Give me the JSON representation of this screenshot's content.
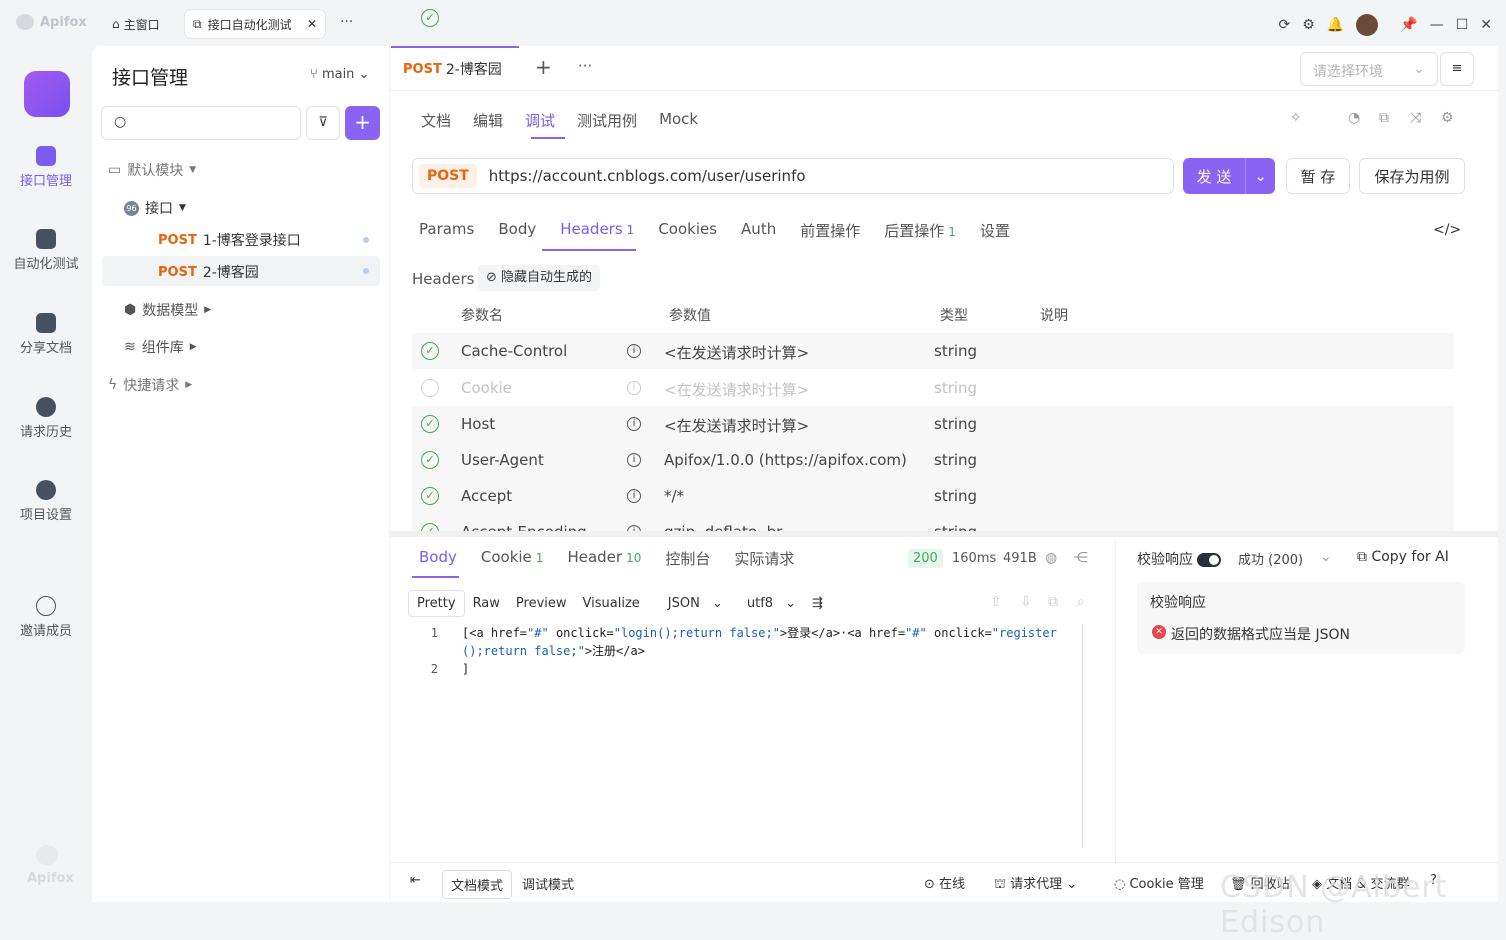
{
  "app": {
    "name": "Apifox"
  },
  "window_tabs": [
    {
      "label": "主窗口"
    },
    {
      "label": "接口自动化测试"
    }
  ],
  "rail": [
    {
      "label": "接口管理"
    },
    {
      "label": "自动化测试"
    },
    {
      "label": "分享文档"
    },
    {
      "label": "请求历史"
    },
    {
      "label": "项目设置"
    },
    {
      "label": "邀请成员"
    }
  ],
  "rail_bottom_logo": "Apifox",
  "nav": {
    "title": "接口管理",
    "branch": "main",
    "tree": {
      "default_module": "默认模块",
      "folder": "接口",
      "folder_badge": "96",
      "items": [
        {
          "method": "POST",
          "name": "1-博客登录接口"
        },
        {
          "method": "POST",
          "name": "2-博客园"
        }
      ],
      "data_models": "数据模型",
      "components": "组件库",
      "quick": "快捷请求"
    }
  },
  "request_tab": {
    "method": "POST",
    "name": "2-博客园"
  },
  "env": {
    "placeholder": "请选择环境"
  },
  "subtabs": [
    "文档",
    "编辑",
    "调试",
    "测试用例",
    "Mock"
  ],
  "url": {
    "method": "POST",
    "value": "https://account.cnblogs.com/user/userinfo"
  },
  "buttons": {
    "send": "发 送",
    "save": "暂 存",
    "save_case": "保存为用例"
  },
  "param_tabs": [
    {
      "label": "Params"
    },
    {
      "label": "Body"
    },
    {
      "label": "Headers",
      "count": "1"
    },
    {
      "label": "Cookies"
    },
    {
      "label": "Auth"
    },
    {
      "label": "前置操作"
    },
    {
      "label": "后置操作",
      "count": "1"
    },
    {
      "label": "设置"
    }
  ],
  "headers_section": {
    "label": "Headers",
    "hide_auto": "隐藏自动生成的"
  },
  "headers_table": {
    "columns": [
      "参数名",
      "参数值",
      "类型",
      "说明"
    ],
    "rows": [
      {
        "name": "Cache-Control",
        "value": "<在发送请求时计算>",
        "type": "string"
      },
      {
        "name": "Cookie",
        "value": "<在发送请求时计算>",
        "type": "string"
      },
      {
        "name": "Host",
        "value": "<在发送请求时计算>",
        "type": "string"
      },
      {
        "name": "User-Agent",
        "value": "Apifox/1.0.0 (https://apifox.com)",
        "type": "string"
      },
      {
        "name": "Accept",
        "value": "*/*",
        "type": "string"
      },
      {
        "name": "Accept-Encoding",
        "value": "gzip, deflate, br",
        "type": "string"
      }
    ]
  },
  "response": {
    "tabs": [
      {
        "label": "Body"
      },
      {
        "label": "Cookie",
        "count": "1"
      },
      {
        "label": "Header",
        "count": "10"
      },
      {
        "label": "控制台"
      },
      {
        "label": "实际请求"
      }
    ],
    "status": "200",
    "time": "160ms",
    "size": "491B",
    "formats": [
      "Pretty",
      "Raw",
      "Preview",
      "Visualize"
    ],
    "lang": "JSON",
    "encoding": "utf8",
    "code": {
      "line1_num": "1",
      "line2_num": "2"
    }
  },
  "validation": {
    "label": "校验响应",
    "status": "成功 (200)",
    "copy_ai": "Copy for AI",
    "box_title": "校验响应",
    "error": "返回的数据格式应当是 JSON"
  },
  "bottom": {
    "doc_mode": "文档模式",
    "debug_mode": "调试模式",
    "online": "在线",
    "proxy": "请求代理",
    "cookie_mgr": "Cookie 管理",
    "recycle": "回收站",
    "docs": "文档 & 交流群"
  },
  "watermark": "CSDN @Albert Edison"
}
